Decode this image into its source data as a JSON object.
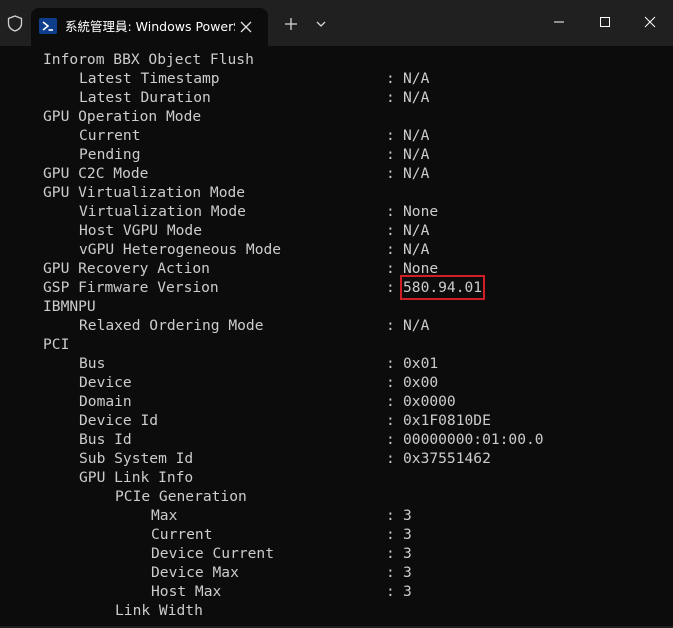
{
  "window": {
    "tab_title": "系統管理員: Windows PowerShell",
    "icons": {
      "shield": "shield-icon",
      "tab_app": "powershell-icon",
      "tab_close": "close-icon",
      "new_tab": "plus-icon",
      "dropdown": "chevron-down-icon",
      "minimize": "minimize-icon",
      "maximize": "maximize-icon",
      "close": "close-icon"
    },
    "colors": {
      "background": "#0c0c0c",
      "titlebar": "#202020",
      "text": "#cccccc",
      "highlight_box": "#d01f27"
    }
  },
  "terminal": {
    "lines": [
      {
        "label": "Inforom BBX Object Flush",
        "indent": 0,
        "value": null
      },
      {
        "label": "Latest Timestamp",
        "indent": 1,
        "value": "N/A"
      },
      {
        "label": "Latest Duration",
        "indent": 1,
        "value": "N/A"
      },
      {
        "label": "GPU Operation Mode",
        "indent": 0,
        "value": null
      },
      {
        "label": "Current",
        "indent": 1,
        "value": "N/A"
      },
      {
        "label": "Pending",
        "indent": 1,
        "value": "N/A"
      },
      {
        "label": "GPU C2C Mode",
        "indent": 0,
        "value": "N/A"
      },
      {
        "label": "GPU Virtualization Mode",
        "indent": 0,
        "value": null
      },
      {
        "label": "Virtualization Mode",
        "indent": 1,
        "value": "None"
      },
      {
        "label": "Host VGPU Mode",
        "indent": 1,
        "value": "N/A"
      },
      {
        "label": "vGPU Heterogeneous Mode",
        "indent": 1,
        "value": "N/A"
      },
      {
        "label": "GPU Recovery Action",
        "indent": 0,
        "value": "None"
      },
      {
        "label": "GSP Firmware Version",
        "indent": 0,
        "value": "580.94.01",
        "highlighted": true
      },
      {
        "label": "IBMNPU",
        "indent": 0,
        "value": null
      },
      {
        "label": "Relaxed Ordering Mode",
        "indent": 1,
        "value": "N/A"
      },
      {
        "label": "PCI",
        "indent": 0,
        "value": null
      },
      {
        "label": "Bus",
        "indent": 1,
        "value": "0x01"
      },
      {
        "label": "Device",
        "indent": 1,
        "value": "0x00"
      },
      {
        "label": "Domain",
        "indent": 1,
        "value": "0x0000"
      },
      {
        "label": "Device Id",
        "indent": 1,
        "value": "0x1F0810DE"
      },
      {
        "label": "Bus Id",
        "indent": 1,
        "value": "00000000:01:00.0"
      },
      {
        "label": "Sub System Id",
        "indent": 1,
        "value": "0x37551462"
      },
      {
        "label": "GPU Link Info",
        "indent": 1,
        "value": null
      },
      {
        "label": "PCIe Generation",
        "indent": 2,
        "value": null
      },
      {
        "label": "Max",
        "indent": 3,
        "value": "3"
      },
      {
        "label": "Current",
        "indent": 3,
        "value": "3"
      },
      {
        "label": "Device Current",
        "indent": 3,
        "value": "3"
      },
      {
        "label": "Device Max",
        "indent": 3,
        "value": "3"
      },
      {
        "label": "Host Max",
        "indent": 3,
        "value": "3"
      },
      {
        "label": "Link Width",
        "indent": 2,
        "value": null
      }
    ]
  }
}
